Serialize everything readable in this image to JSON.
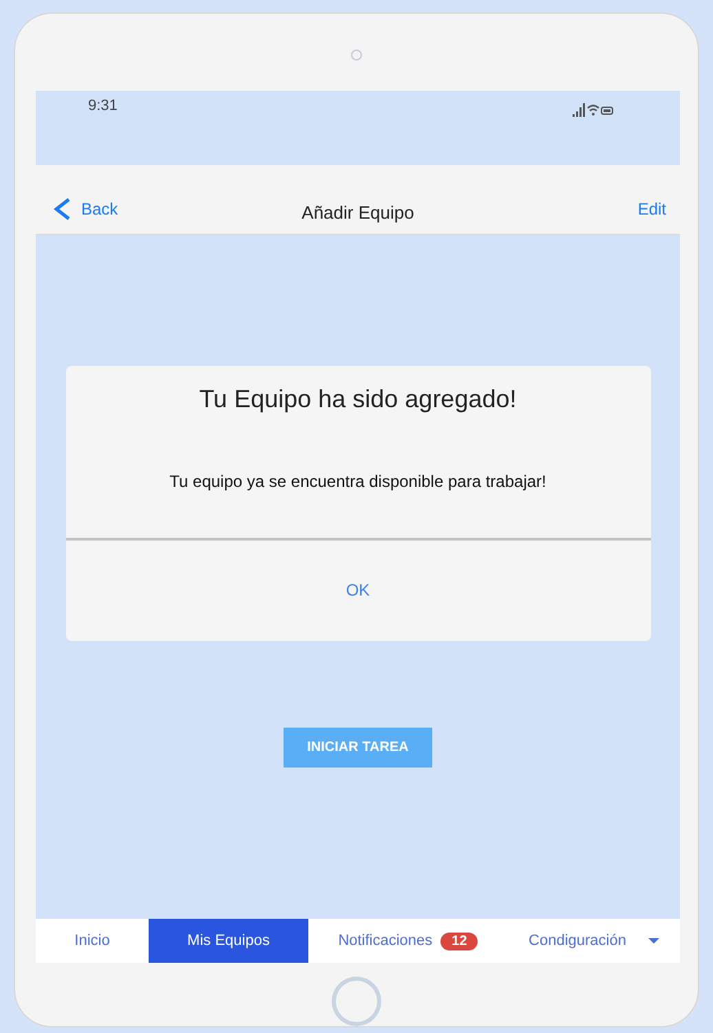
{
  "status_bar": {
    "time": "9:31"
  },
  "nav_bar": {
    "back": "Back",
    "title": "Añadir Equipo",
    "action": "Edit"
  },
  "dialog": {
    "title": "Tu Equipo ha sido agregado!",
    "message": "Tu equipo ya se encuentra disponible para trabajar!",
    "button": "OK"
  },
  "primary_button": "INICIAR TAREA",
  "tabs": [
    {
      "label": "Inicio",
      "selected": false
    },
    {
      "label": "Mis Equipos",
      "selected": true
    },
    {
      "label": "Notificaciones",
      "selected": false,
      "badge": "12"
    },
    {
      "label": "Condiguración",
      "selected": false,
      "dropdown": true
    }
  ]
}
